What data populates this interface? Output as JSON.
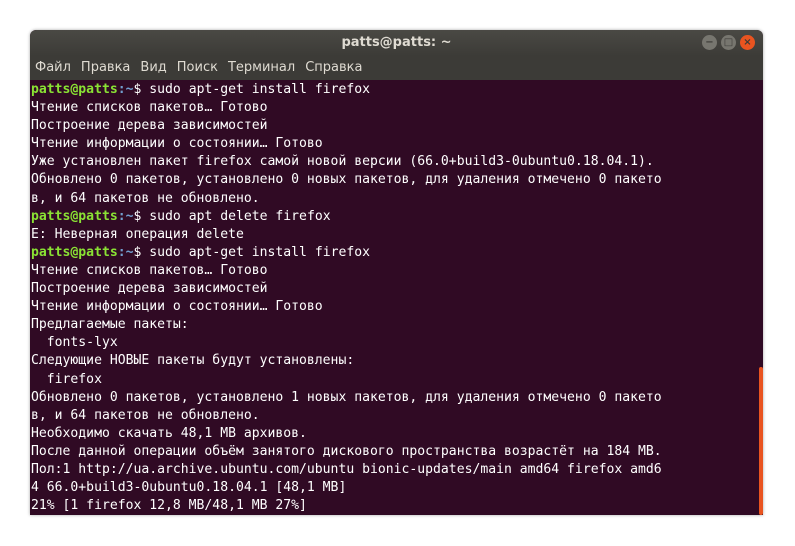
{
  "window": {
    "title": "patts@patts: ~"
  },
  "controls": {
    "minimize": "−",
    "maximize": "□",
    "close": "×"
  },
  "menu": [
    "Файл",
    "Правка",
    "Вид",
    "Поиск",
    "Терминал",
    "Справка"
  ],
  "colors": {
    "background": "#300a24",
    "prompt_user": "#8ae234",
    "prompt_path": "#729fcf",
    "scroll_thumb": "#e95420"
  },
  "terminal": {
    "lines": [
      {
        "prompt": {
          "user": "patts@patts",
          "path": ":~",
          "sign": "$ "
        },
        "text": "sudo apt-get install firefox"
      },
      {
        "text": "Чтение списков пакетов… Готово"
      },
      {
        "text": "Построение дерева зависимостей"
      },
      {
        "text": "Чтение информации о состоянии… Готово"
      },
      {
        "text": "Уже установлен пакет firefox самой новой версии (66.0+build3-0ubuntu0.18.04.1)."
      },
      {
        "text": "Обновлено 0 пакетов, установлено 0 новых пакетов, для удаления отмечено 0 пакето"
      },
      {
        "text": "в, и 64 пакетов не обновлено."
      },
      {
        "prompt": {
          "user": "patts@patts",
          "path": ":~",
          "sign": "$ "
        },
        "text": "sudo apt delete firefox"
      },
      {
        "text": "E: Неверная операция delete"
      },
      {
        "prompt": {
          "user": "patts@patts",
          "path": ":~",
          "sign": "$ "
        },
        "text": "sudo apt-get install firefox"
      },
      {
        "text": "Чтение списков пакетов… Готово"
      },
      {
        "text": "Построение дерева зависимостей"
      },
      {
        "text": "Чтение информации о состоянии… Готово"
      },
      {
        "text": "Предлагаемые пакеты:"
      },
      {
        "text": "  fonts-lyx"
      },
      {
        "text": "Следующие НОВЫЕ пакеты будут установлены:"
      },
      {
        "text": "  firefox"
      },
      {
        "text": "Обновлено 0 пакетов, установлено 1 новых пакетов, для удаления отмечено 0 пакето"
      },
      {
        "text": "в, и 64 пакетов не обновлено."
      },
      {
        "text": "Необходимо скачать 48,1 MB архивов."
      },
      {
        "text": "После данной операции объём занятого дискового пространства возрастёт на 184 MB."
      },
      {
        "text": "Пол:1 http://ua.archive.ubuntu.com/ubuntu bionic-updates/main amd64 firefox amd6"
      },
      {
        "text": "4 66.0+build3-0ubuntu0.18.04.1 [48,1 MB]"
      },
      {
        "text": "21% [1 firefox 12,8 MB/48,1 MB 27%]"
      }
    ]
  }
}
